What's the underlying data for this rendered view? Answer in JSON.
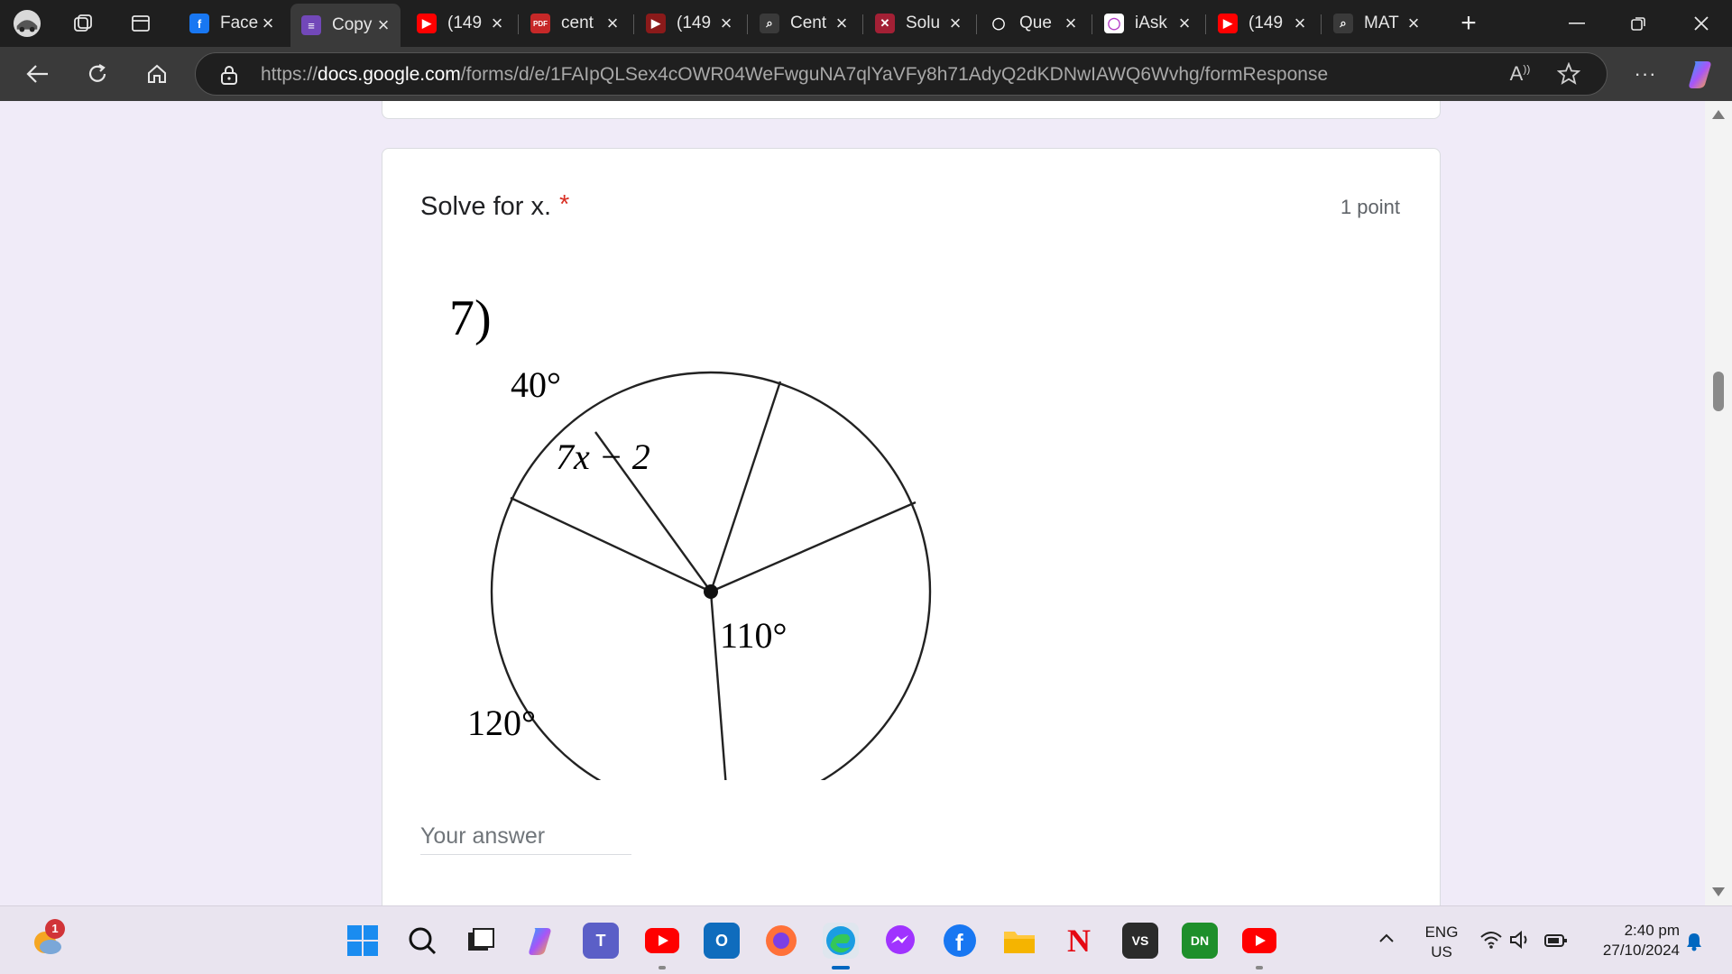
{
  "browser": {
    "tabs": [
      {
        "title": "Face",
        "favicon": "facebook-icon",
        "color": "#1877f2",
        "glyph": "f"
      },
      {
        "title": "Copy",
        "favicon": "google-forms-icon",
        "color": "#7248b9",
        "glyph": "≡"
      },
      {
        "title": "(149",
        "favicon": "youtube-icon",
        "color": "#ff0000",
        "glyph": "▶"
      },
      {
        "title": "cent",
        "favicon": "pdf-icon",
        "color": "#c62828",
        "glyph": "PDF"
      },
      {
        "title": "(149",
        "favicon": "youtube-dark-icon",
        "color": "#8b1a1a",
        "glyph": "▶"
      },
      {
        "title": "Cent",
        "favicon": "search-icon",
        "color": "#3a3a3a",
        "glyph": "⌕"
      },
      {
        "title": "Solu",
        "favicon": "solution-site-icon",
        "color": "#a32035",
        "glyph": "✕"
      },
      {
        "title": "Que",
        "favicon": "ring-icon",
        "color": "#1f1f1f",
        "glyph": "◯"
      },
      {
        "title": "iAsk",
        "favicon": "iask-icon",
        "color": "#ffffff",
        "glyph": "◯"
      },
      {
        "title": "(149",
        "favicon": "youtube-icon",
        "color": "#ff0000",
        "glyph": "▶"
      },
      {
        "title": "MAT",
        "favicon": "search-icon",
        "color": "#3a3a3a",
        "glyph": "⌕"
      }
    ],
    "active_tab": 1,
    "url_scheme": "https://",
    "url_host": "docs.google.com",
    "url_path": "/forms/d/e/1FAIpQLSex4cOWR04WeFwguNA7qlYaVFy8h71AdyQ2dKDNwIAWQ6Wvhg/formResponse"
  },
  "question": {
    "title": "Solve for x.",
    "required_mark": "*",
    "points": "1 point",
    "figure": {
      "problem_number": "7)",
      "diagram": "circle divided into five central angles",
      "labels": [
        "40°",
        "7x − 2",
        "110°",
        "120°"
      ]
    },
    "answer_placeholder": "Your answer"
  },
  "taskbar": {
    "weather_badge": "1",
    "apps": [
      "windows-start-icon",
      "search-icon",
      "task-view-icon",
      "copilot-icon",
      "teams-icon",
      "youtube-icon",
      "outlook-icon",
      "firefox-icon",
      "edge-icon",
      "messenger-icon",
      "facebook-icon",
      "file-explorer-icon",
      "netflix-icon",
      "vs-app-icon",
      "game-app-icon",
      "youtube-icon"
    ],
    "lang_line1": "ENG",
    "lang_line2": "US",
    "time": "2:40 pm",
    "date": "27/10/2024"
  }
}
